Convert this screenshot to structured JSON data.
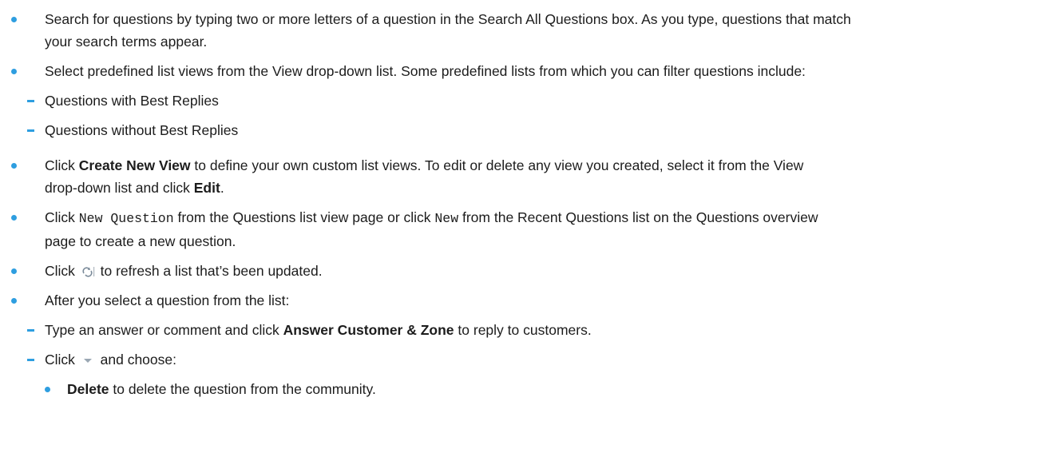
{
  "items": [
    {
      "text1": "Search for questions by typing two or more letters of a question in the Search All Questions box. As you type, questions that match",
      "text2": "your search terms appear."
    },
    {
      "text": "Select predefined list views from the View drop-down list. Some predefined lists from which you can filter questions include:",
      "sub": [
        "Questions with Best Replies",
        "Questions without Best Replies"
      ]
    },
    {
      "click": "Click ",
      "bold1": "Create New View",
      "mid": " to define your own custom list views. To edit or delete any view you created, select it from the View",
      "line2": "drop-down list and click ",
      "bold2": "Edit",
      "end": "."
    },
    {
      "click": "Click ",
      "code1": "New Question",
      "mid": " from the Questions list view page or click ",
      "code2": "New",
      "rest": " from the Recent Questions list on the Questions overview",
      "line2": "page to create a new question."
    },
    {
      "click": "Click ",
      "icon": "refresh-icon",
      "rest": " to refresh a list that’s been updated."
    },
    {
      "text": "After you select a question from the list:",
      "sub": [
        {
          "pre": "Type an answer or comment and click ",
          "bold": "Answer Customer & Zone",
          "post": " to reply to customers."
        },
        {
          "pre": "Click ",
          "icon": "chevron-down-icon",
          "post": " and choose:",
          "sub": [
            {
              "bold": "Delete",
              "post": " to delete the question from the community."
            }
          ]
        }
      ]
    }
  ],
  "colors": {
    "bullet": "#2e9ee0",
    "text": "#1c1c1c"
  }
}
